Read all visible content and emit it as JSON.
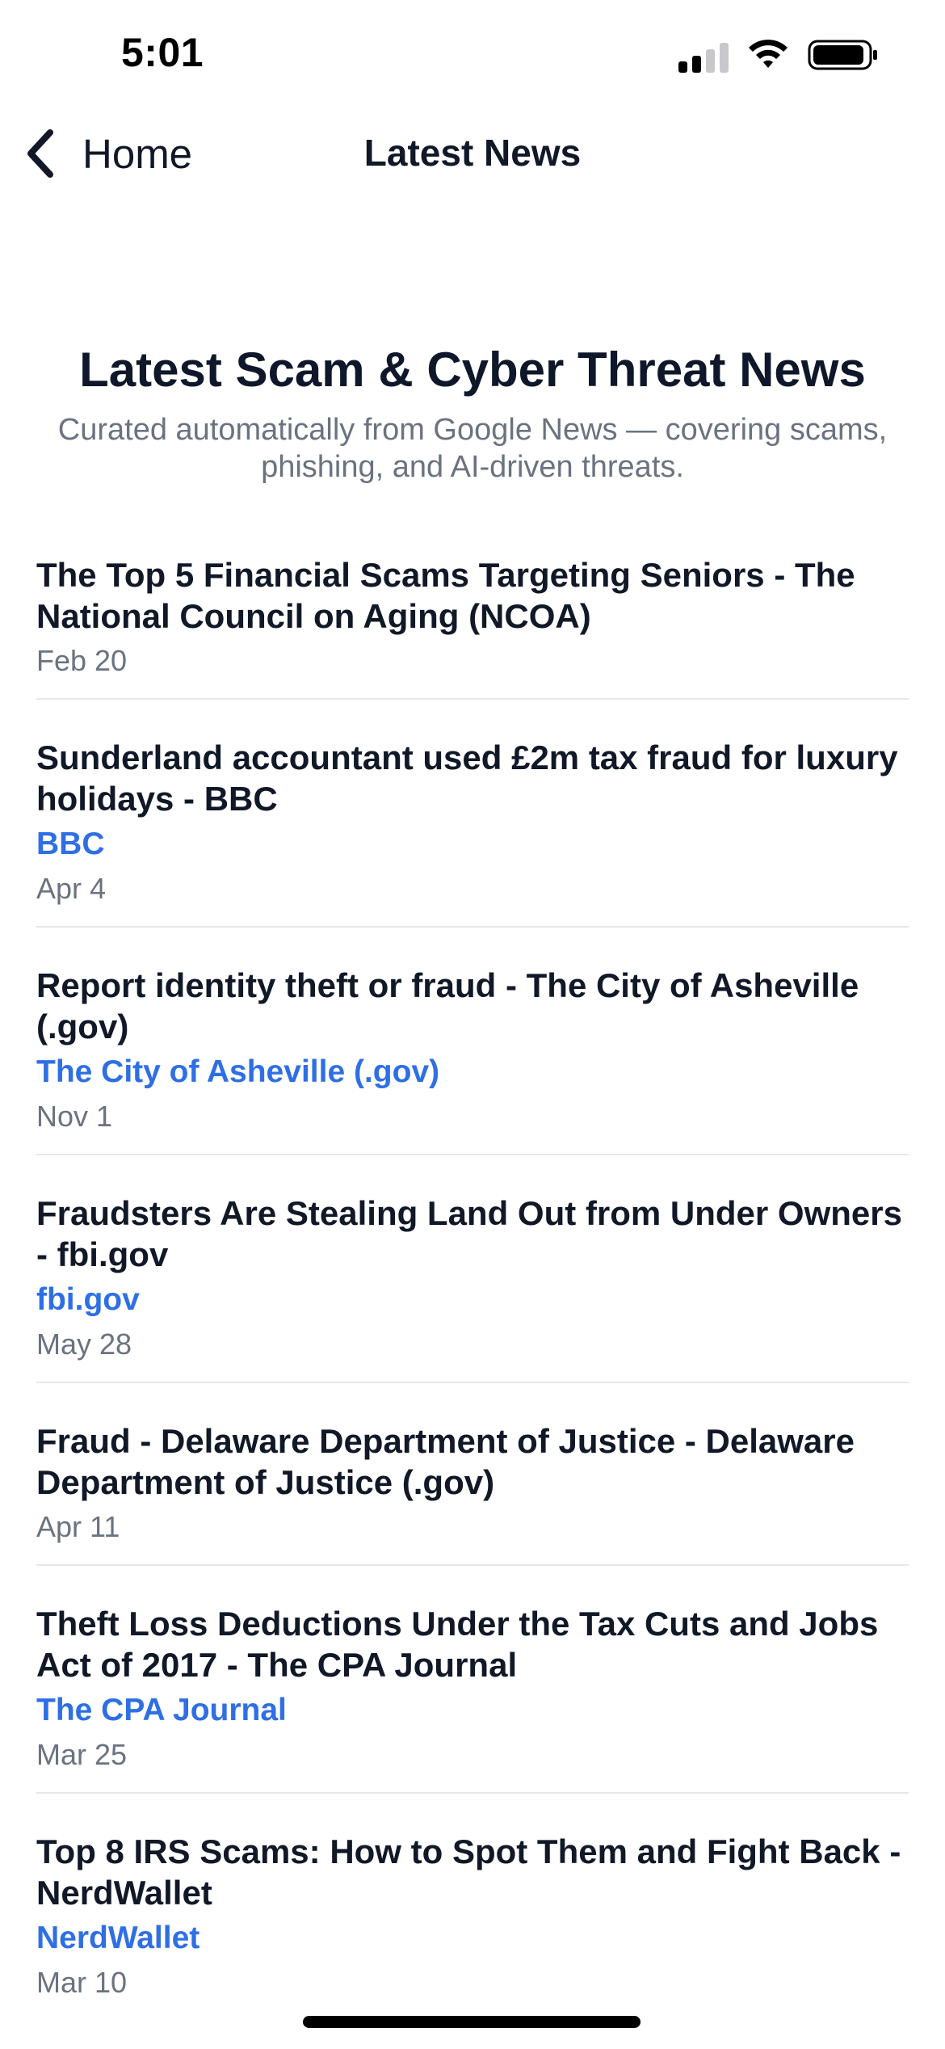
{
  "status_bar": {
    "time": "5:01"
  },
  "nav": {
    "back_label": "Home",
    "title": "Latest News"
  },
  "header": {
    "title": "Latest Scam & Cyber Threat News",
    "subtitle": "Curated automatically from Google News — covering scams, phishing, and AI-driven threats."
  },
  "colors": {
    "accent": "#2f6fe4",
    "text": "#111827",
    "muted": "#6b7280",
    "divider": "#e5e7eb"
  },
  "news": [
    {
      "title": "The Top 5 Financial Scams Targeting Seniors - The National Council on Aging (NCOA)",
      "source": "",
      "date": "Feb 20"
    },
    {
      "title": "Sunderland accountant used £2m tax fraud for luxury holidays - BBC",
      "source": "BBC",
      "date": "Apr 4"
    },
    {
      "title": "Report identity theft or fraud - The City of Asheville (.gov)",
      "source": "The City of Asheville (.gov)",
      "date": "Nov 1"
    },
    {
      "title": "Fraudsters Are Stealing Land Out from Under Owners - fbi.gov",
      "source": "fbi.gov",
      "date": "May 28"
    },
    {
      "title": "Fraud - Delaware Department of Justice - Delaware Department of Justice (.gov)",
      "source": "",
      "date": "Apr 11"
    },
    {
      "title": "Theft Loss Deductions Under the Tax Cuts and Jobs Act of 2017 - The CPA Journal",
      "source": "The CPA Journal",
      "date": "Mar 25"
    },
    {
      "title": "Top 8 IRS Scams: How to Spot Them and Fight Back - NerdWallet",
      "source": "NerdWallet",
      "date": "Mar 10"
    }
  ]
}
